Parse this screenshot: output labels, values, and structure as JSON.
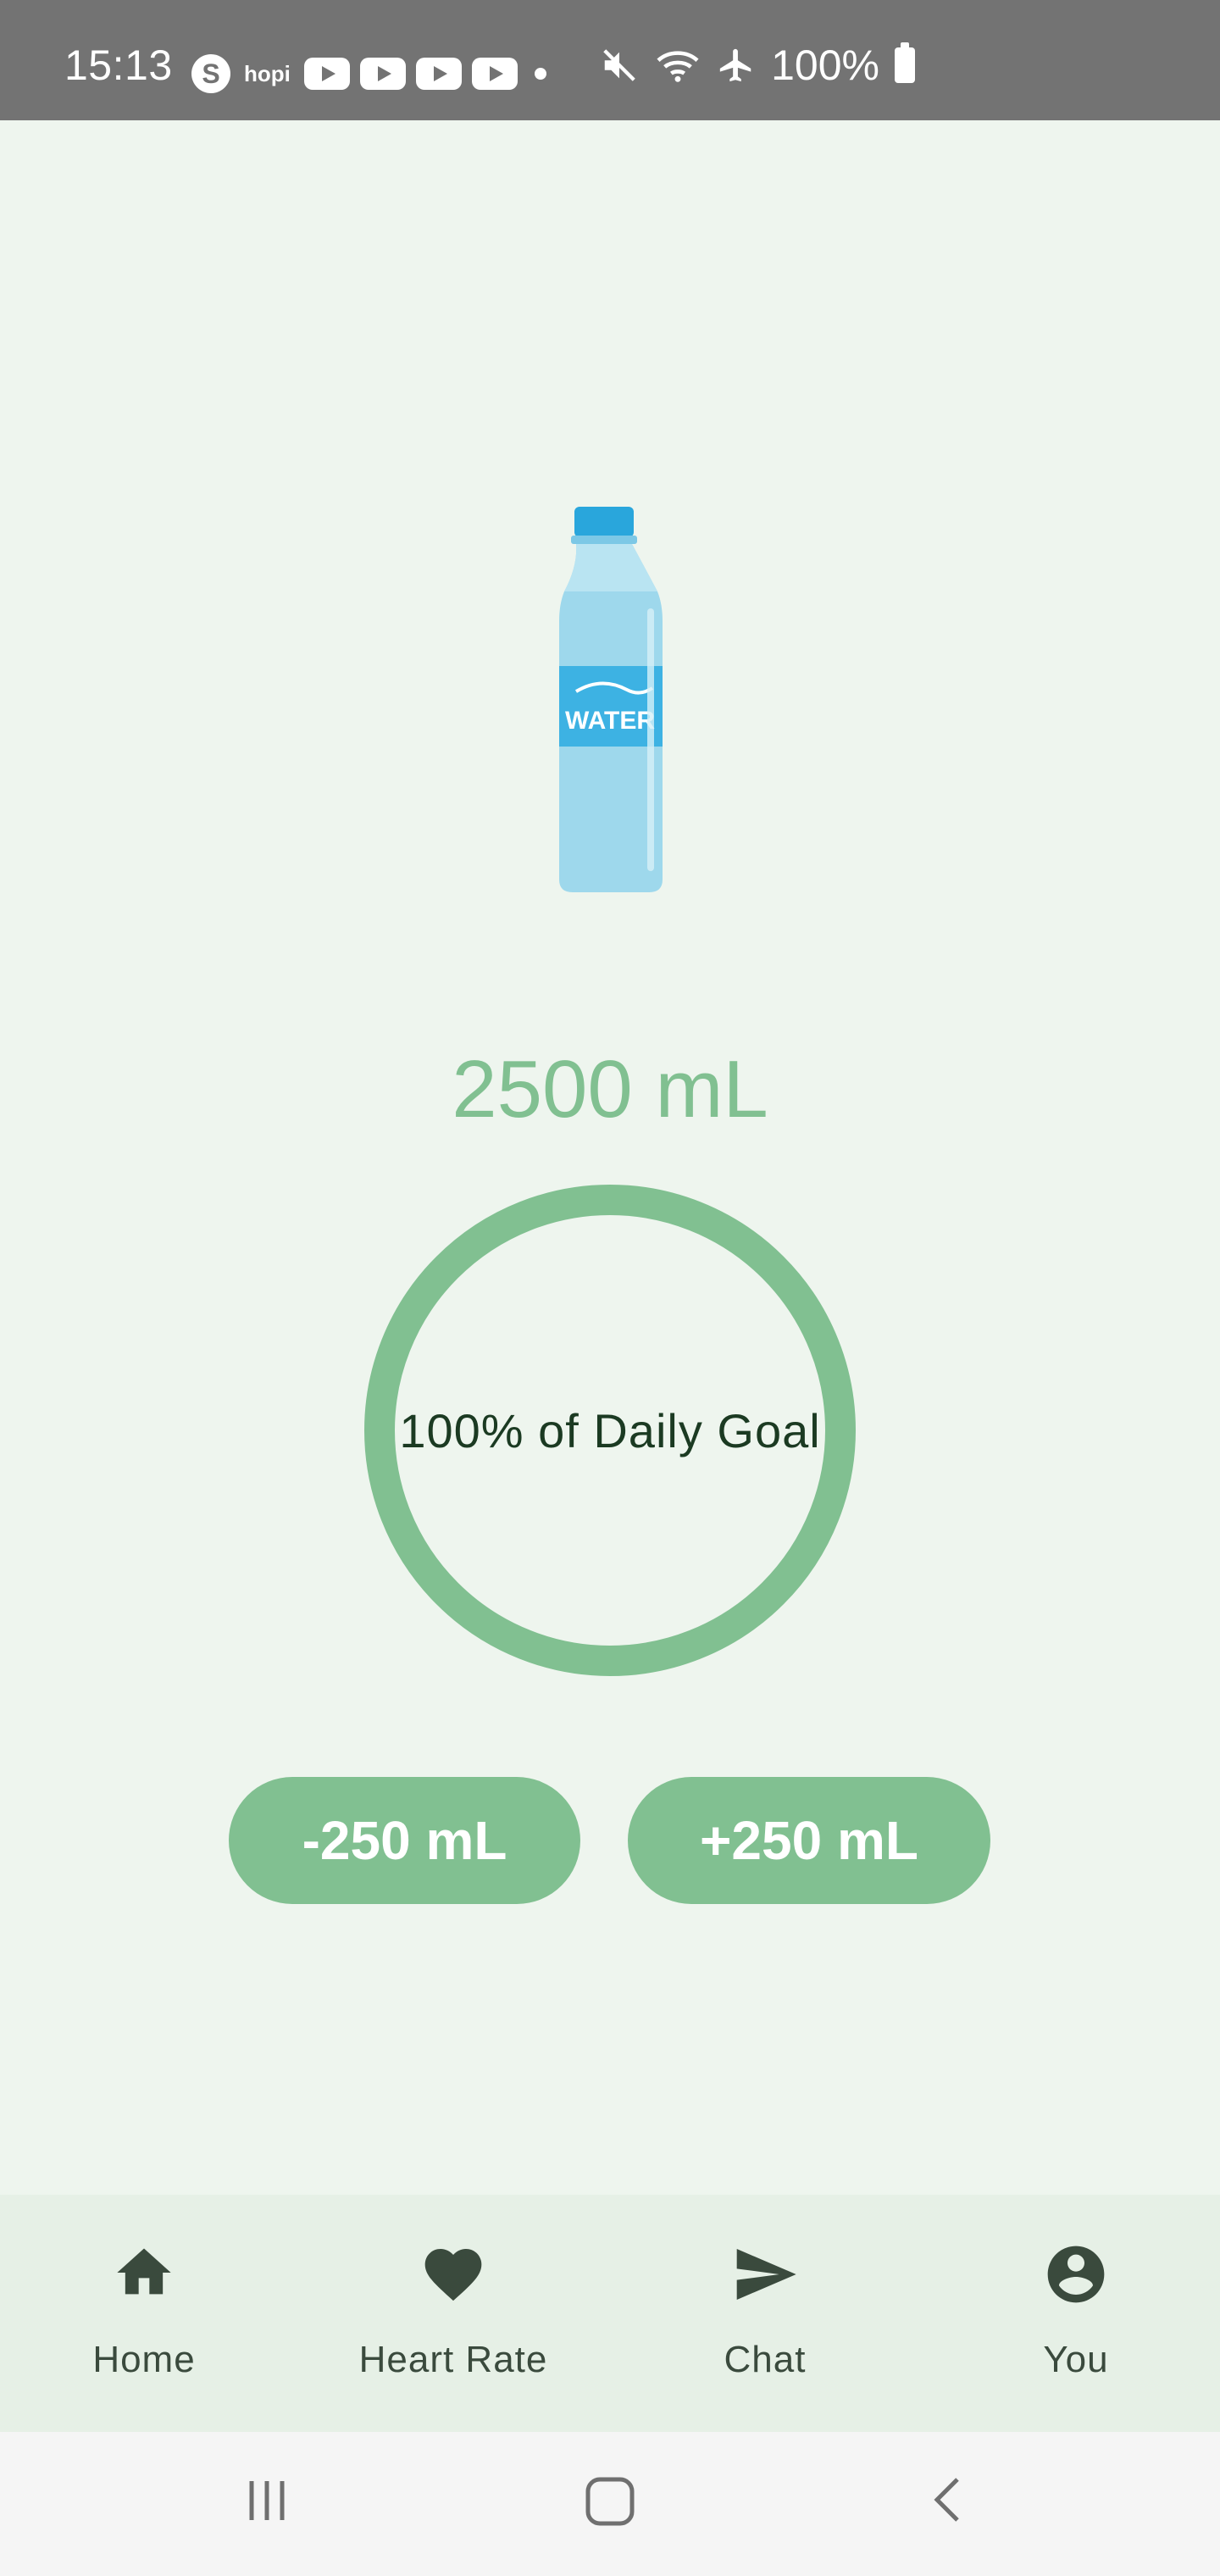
{
  "status_bar": {
    "time": "15:13",
    "notification_icons": [
      "skype-icon",
      "hopi-icon",
      "youtube-icon",
      "youtube-icon",
      "youtube-icon",
      "youtube-icon",
      "dot-icon"
    ],
    "hopi_label": "hopi",
    "skype_label": "S",
    "system_icons": [
      "mute-icon",
      "wifi-icon",
      "airplane-icon"
    ],
    "battery": "100%"
  },
  "hydration": {
    "bottle_label": "WATER",
    "amount": "2500 mL",
    "goal_text": "100% of Daily Goal",
    "goal_percent": 100,
    "accent_color": "#81c091"
  },
  "actions": {
    "decrease_label": "-250 mL",
    "increase_label": "+250 mL"
  },
  "bottom_nav": {
    "items": [
      {
        "label": "Home",
        "icon": "home-icon"
      },
      {
        "label": "Heart Rate",
        "icon": "heart-icon"
      },
      {
        "label": "Chat",
        "icon": "send-icon"
      },
      {
        "label": "You",
        "icon": "account-circle-icon"
      }
    ]
  },
  "system_nav": {
    "buttons": [
      "recents-icon",
      "home-button-icon",
      "back-icon"
    ]
  }
}
